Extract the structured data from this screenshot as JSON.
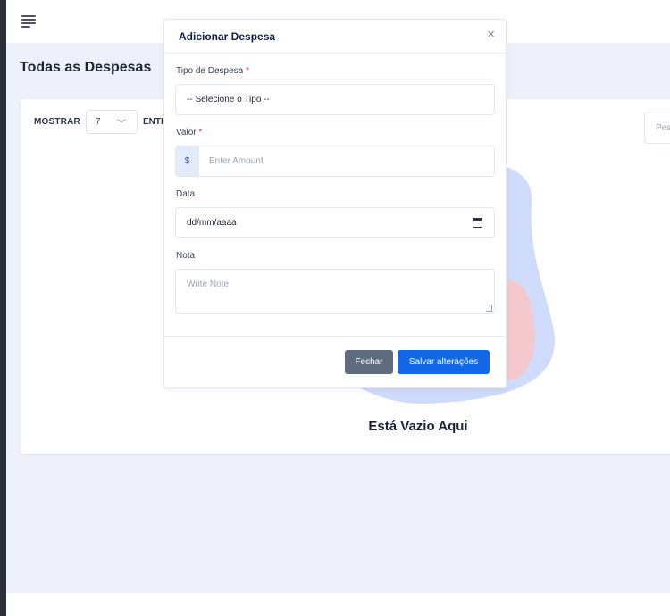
{
  "page": {
    "title": "Todas as Despesas"
  },
  "table_controls": {
    "show_label": "MOSTRAR",
    "show_value": "7",
    "entries_label": "ENTI",
    "search_placeholder": "Pes"
  },
  "empty_state": {
    "text": "Está Vazio Aqui"
  },
  "modal": {
    "title": "Adicionar Despesa",
    "close_symbol": "×",
    "fields": {
      "type": {
        "label": "Tipo de Despesa",
        "required_mark": "*",
        "value": "-- Selecione o Tipo --"
      },
      "amount": {
        "label": "Valor",
        "required_mark": "*",
        "prefix": "$",
        "placeholder": "Enter Amount"
      },
      "date": {
        "label": "Data",
        "value": "dd/mm/aaaa"
      },
      "note": {
        "label": "Nota",
        "placeholder": "Write Note"
      }
    },
    "buttons": {
      "close": "Fechar",
      "save": "Salvar alterações"
    }
  },
  "colors": {
    "primary": "#1368e8",
    "secondary": "#5f6b7e",
    "required": "#e0364b",
    "background": "#eef1f9"
  },
  "icons": [
    "menu-icon",
    "chevron-down-icon",
    "close-icon",
    "calendar-icon"
  ]
}
